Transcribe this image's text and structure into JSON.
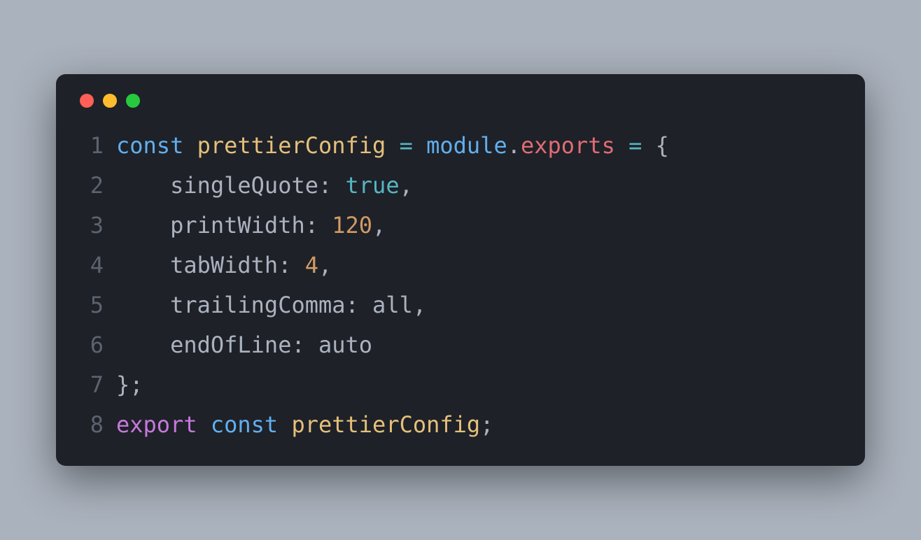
{
  "window": {
    "traffic_lights": {
      "close": "#ff5f56",
      "minimize": "#ffbd2e",
      "zoom": "#27c93f"
    }
  },
  "code": {
    "lines": [
      {
        "num": "1",
        "tokens": [
          {
            "t": "const ",
            "c": "tk-const"
          },
          {
            "t": "prettierConfig",
            "c": "tk-ident"
          },
          {
            "t": " ",
            "c": "tk-plain"
          },
          {
            "t": "=",
            "c": "tk-op"
          },
          {
            "t": " ",
            "c": "tk-plain"
          },
          {
            "t": "module",
            "c": "tk-var"
          },
          {
            "t": ".",
            "c": "tk-dot"
          },
          {
            "t": "exports",
            "c": "tk-member"
          },
          {
            "t": " ",
            "c": "tk-plain"
          },
          {
            "t": "=",
            "c": "tk-op"
          },
          {
            "t": " ",
            "c": "tk-plain"
          },
          {
            "t": "{",
            "c": "tk-punct"
          }
        ]
      },
      {
        "num": "2",
        "tokens": [
          {
            "t": "    ",
            "c": "tk-plain"
          },
          {
            "t": "singleQuote",
            "c": "tk-prop"
          },
          {
            "t": ":",
            "c": "tk-punct"
          },
          {
            "t": " ",
            "c": "tk-plain"
          },
          {
            "t": "true",
            "c": "tk-bool"
          },
          {
            "t": ",",
            "c": "tk-punct"
          }
        ]
      },
      {
        "num": "3",
        "tokens": [
          {
            "t": "    ",
            "c": "tk-plain"
          },
          {
            "t": "printWidth",
            "c": "tk-prop"
          },
          {
            "t": ":",
            "c": "tk-punct"
          },
          {
            "t": " ",
            "c": "tk-plain"
          },
          {
            "t": "120",
            "c": "tk-num"
          },
          {
            "t": ",",
            "c": "tk-punct"
          }
        ]
      },
      {
        "num": "4",
        "tokens": [
          {
            "t": "    ",
            "c": "tk-plain"
          },
          {
            "t": "tabWidth",
            "c": "tk-prop"
          },
          {
            "t": ":",
            "c": "tk-punct"
          },
          {
            "t": " ",
            "c": "tk-plain"
          },
          {
            "t": "4",
            "c": "tk-num"
          },
          {
            "t": ",",
            "c": "tk-punct"
          }
        ]
      },
      {
        "num": "5",
        "tokens": [
          {
            "t": "    ",
            "c": "tk-plain"
          },
          {
            "t": "trailingComma",
            "c": "tk-prop"
          },
          {
            "t": ":",
            "c": "tk-punct"
          },
          {
            "t": " ",
            "c": "tk-plain"
          },
          {
            "t": "all",
            "c": "tk-plain"
          },
          {
            "t": ",",
            "c": "tk-punct"
          }
        ]
      },
      {
        "num": "6",
        "tokens": [
          {
            "t": "    ",
            "c": "tk-plain"
          },
          {
            "t": "endOfLine",
            "c": "tk-prop"
          },
          {
            "t": ":",
            "c": "tk-punct"
          },
          {
            "t": " ",
            "c": "tk-plain"
          },
          {
            "t": "auto",
            "c": "tk-plain"
          }
        ]
      },
      {
        "num": "7",
        "tokens": [
          {
            "t": "};",
            "c": "tk-punct"
          }
        ]
      },
      {
        "num": "8",
        "tokens": [
          {
            "t": "export ",
            "c": "tk-keyword"
          },
          {
            "t": "const ",
            "c": "tk-const"
          },
          {
            "t": "prettierConfig",
            "c": "tk-ident"
          },
          {
            "t": ";",
            "c": "tk-punct"
          }
        ]
      }
    ]
  }
}
